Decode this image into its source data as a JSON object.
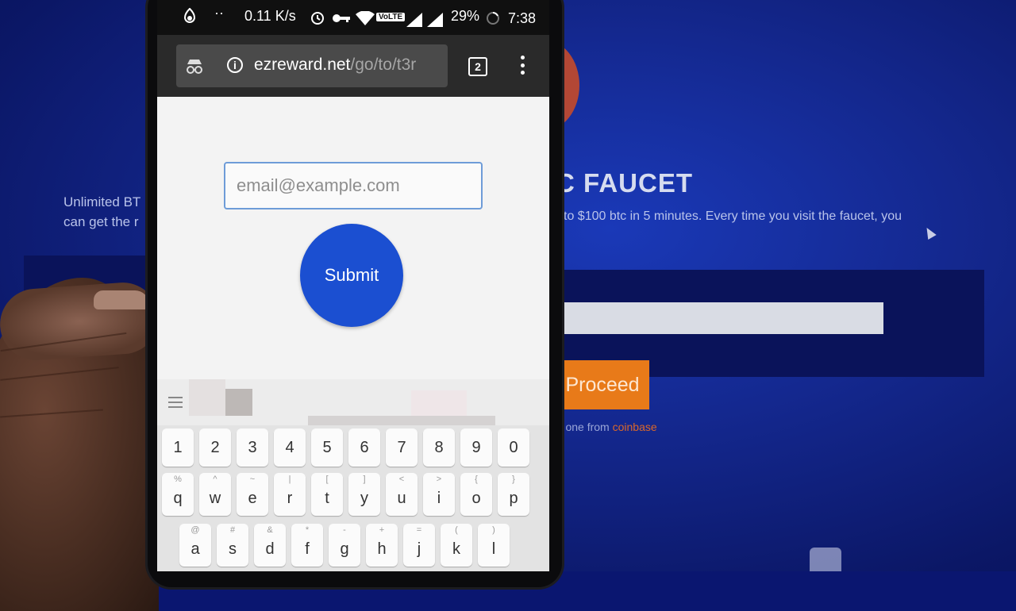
{
  "background": {
    "title": "C FAUCET",
    "desc_right": "to $100 btc in 5 minutes. Every time you visit the faucet, you",
    "desc_left_line1": "Unlimited BT",
    "desc_left_line2": "can get the r",
    "proceed_label": "Proceed",
    "grab_text": "ab one from ",
    "grab_link": "coinbase"
  },
  "status_bar": {
    "speed": "0.11 K/s",
    "network": "VoLTE",
    "battery": "29%",
    "time": "7:38"
  },
  "browser": {
    "url_domain": "ezreward.net",
    "url_path": "/go/to/t3r",
    "tab_count": "2"
  },
  "page": {
    "email_placeholder": "email@example.com",
    "submit_label": "Submit"
  },
  "keyboard": {
    "number_row": [
      "1",
      "2",
      "3",
      "4",
      "5",
      "6",
      "7",
      "8",
      "9",
      "0"
    ],
    "row1": [
      {
        "key": "q",
        "hint": "%"
      },
      {
        "key": "w",
        "hint": "^"
      },
      {
        "key": "e",
        "hint": "~"
      },
      {
        "key": "r",
        "hint": "|"
      },
      {
        "key": "t",
        "hint": "["
      },
      {
        "key": "y",
        "hint": "]"
      },
      {
        "key": "u",
        "hint": "<"
      },
      {
        "key": "i",
        "hint": ">"
      },
      {
        "key": "o",
        "hint": "{"
      },
      {
        "key": "p",
        "hint": "}"
      }
    ],
    "row2": [
      {
        "key": "a",
        "hint": "@"
      },
      {
        "key": "s",
        "hint": "#"
      },
      {
        "key": "d",
        "hint": "&"
      },
      {
        "key": "f",
        "hint": "*"
      },
      {
        "key": "g",
        "hint": "-"
      },
      {
        "key": "h",
        "hint": "+"
      },
      {
        "key": "j",
        "hint": "="
      },
      {
        "key": "k",
        "hint": "("
      },
      {
        "key": "l",
        "hint": ")"
      }
    ]
  }
}
